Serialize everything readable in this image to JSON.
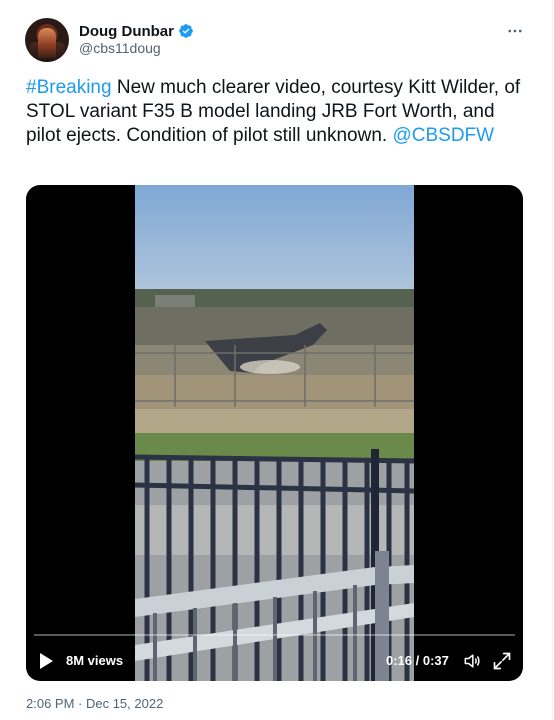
{
  "author": {
    "display_name": "Doug Dunbar",
    "handle": "@cbs11doug",
    "verified": true,
    "avatar_icon": "user-avatar-icon",
    "more_icon": "more-horizontal-icon"
  },
  "tweet": {
    "hashtag": "#Breaking",
    "text_main": " New much clearer video, courtesy Kitt Wilder, of STOL variant F35 B model landing JRB Fort Worth, and pilot ejects. Condition of pilot still unknown. ",
    "mention": "@CBSDFW",
    "timestamp": "2:06 PM · Dec 15, 2022"
  },
  "video": {
    "views_label": "8M views",
    "time_label": "0:16 / 0:37",
    "progress_fraction": 0.0,
    "play_icon": "play-icon",
    "volume_icon": "volume-icon",
    "fullscreen_icon": "fullscreen-icon"
  },
  "colors": {
    "link": "#1d9bf0",
    "secondary_text": "#536471",
    "primary_text": "#0f1419"
  }
}
